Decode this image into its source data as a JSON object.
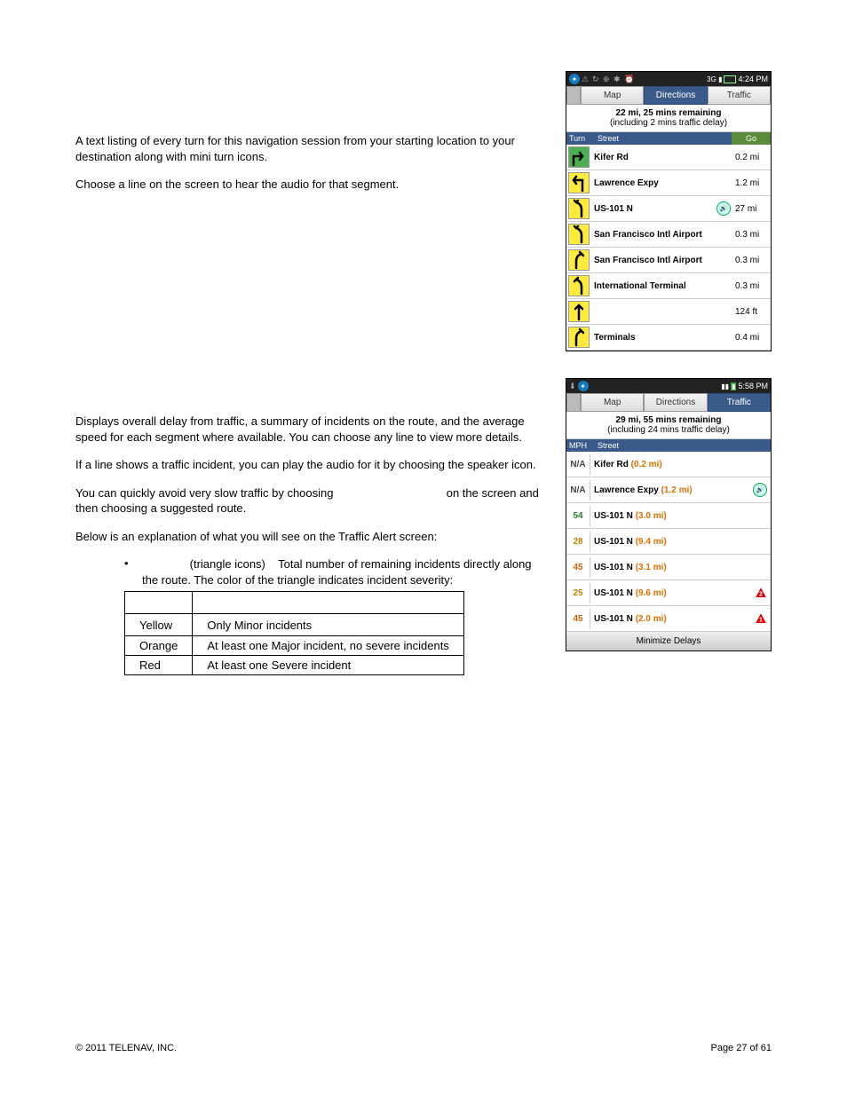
{
  "section1": {
    "para1": "A text listing of every turn for this navigation session from your starting location to your destination along with mini turn icons.",
    "para2": "Choose a line on the screen to hear the audio for that segment."
  },
  "screenshot1": {
    "time": "4:24 PM",
    "tabs": {
      "map": "Map",
      "directions": "Directions",
      "traffic": "Traffic",
      "active": "directions"
    },
    "summary_line1": "22 mi, 25 mins remaining",
    "summary_line2": "(including 2 mins traffic delay)",
    "col_turn": "Turn",
    "col_street": "Street",
    "col_go": "Go",
    "rows": [
      {
        "icon": "turn-start",
        "iconClass": "green",
        "street": "Kifer Rd",
        "dist": "0.2 mi",
        "speaker": false
      },
      {
        "icon": "turn-left",
        "iconClass": "",
        "street": "Lawrence Expy",
        "dist": "1.2 mi",
        "speaker": false
      },
      {
        "icon": "merge-left",
        "iconClass": "",
        "street": "US-101 N",
        "dist": "27 mi",
        "speaker": true
      },
      {
        "icon": "merge-left",
        "iconClass": "",
        "street": "San Francisco Intl Airport",
        "dist": "0.3 mi",
        "speaker": false
      },
      {
        "icon": "bear-right",
        "iconClass": "",
        "street": "San Francisco Intl Airport",
        "dist": "0.3 mi",
        "speaker": false
      },
      {
        "icon": "bear-left",
        "iconClass": "",
        "street": "International Terminal",
        "dist": "0.3 mi",
        "speaker": false
      },
      {
        "icon": "straight",
        "iconClass": "",
        "street": "",
        "dist": "124 ft",
        "speaker": false
      },
      {
        "icon": "bear-right",
        "iconClass": "",
        "street": "Terminals",
        "dist": "0.4 mi",
        "speaker": false
      }
    ]
  },
  "section2": {
    "para1": "Displays overall delay from traffic, a summary of incidents on the route, and the average speed for each segment where available. You can choose any line to view more details.",
    "para2": "If a line shows a traffic incident, you can play the audio for it by choosing the speaker icon.",
    "para3a": "You can quickly avoid very slow traffic by choosing ",
    "para3b": " on the screen and then choosing a suggested route.",
    "para4": "Below is an explanation of what you will see on the Traffic Alert screen:",
    "bullet_label": "(triangle icons)",
    "bullet_text": "Total number of remaining incidents directly along the route. The color of the triangle indicates incident severity:"
  },
  "severity_table": {
    "rows": [
      {
        "color": "Yellow",
        "meaning": "Only Minor incidents"
      },
      {
        "color": "Orange",
        "meaning": "At least one Major incident, no severe incidents"
      },
      {
        "color": "Red",
        "meaning": "At least one Severe incident"
      }
    ]
  },
  "screenshot2": {
    "time": "5:58 PM",
    "tabs": {
      "map": "Map",
      "directions": "Directions",
      "traffic": "Traffic",
      "active": "traffic"
    },
    "summary_line1": "29 mi, 55 mins remaining",
    "summary_line2": "(including 24 mins traffic delay)",
    "col_mph": "MPH",
    "col_street": "Street",
    "rows": [
      {
        "mph": "N/A",
        "mphClass": "mph-na",
        "street": "Kifer Rd",
        "mi": "(0.2 mi)",
        "speaker": false,
        "tri": ""
      },
      {
        "mph": "N/A",
        "mphClass": "mph-na",
        "street": "Lawrence Expy",
        "mi": "(1.2 mi)",
        "speaker": true,
        "tri": ""
      },
      {
        "mph": "54",
        "mphClass": "mph-green",
        "street": "US-101 N",
        "mi": "(3.0 mi)",
        "speaker": false,
        "tri": ""
      },
      {
        "mph": "28",
        "mphClass": "mph-yellow",
        "street": "US-101 N",
        "mi": "(9.4 mi)",
        "speaker": false,
        "tri": ""
      },
      {
        "mph": "45",
        "mphClass": "mph-orange",
        "street": "US-101 N",
        "mi": "(3.1 mi)",
        "speaker": false,
        "tri": ""
      },
      {
        "mph": "25",
        "mphClass": "mph-yellow",
        "street": "US-101 N",
        "mi": "(9.6 mi)",
        "speaker": false,
        "tri": "red",
        "tnum": "2"
      },
      {
        "mph": "45",
        "mphClass": "mph-orange",
        "street": "US-101 N",
        "mi": "(2.0 mi)",
        "speaker": false,
        "tri": "red",
        "tnum": "1"
      }
    ],
    "minimize": "Minimize Delays"
  },
  "footer": {
    "copyright": "© 2011 TELENAV, INC.",
    "page": "Page 27 of 61"
  }
}
